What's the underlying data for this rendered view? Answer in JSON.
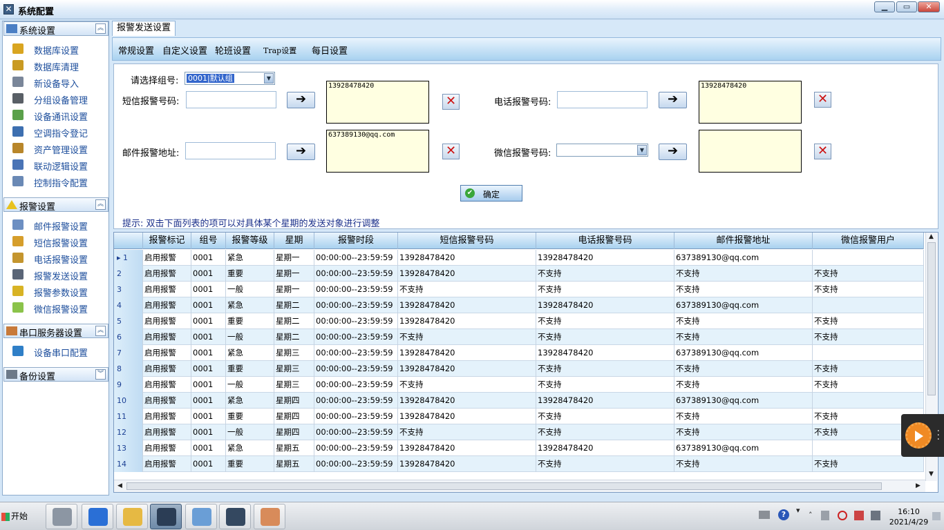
{
  "window": {
    "title": "系统配置",
    "min": "▁",
    "max": "▭",
    "close": "✕"
  },
  "sidebar": {
    "sections": [
      {
        "label": "系统设置",
        "toggle": "︽",
        "items": [
          {
            "label": "数据库设置",
            "icon": "database-icon",
            "color": "#d9a520"
          },
          {
            "label": "数据库清理",
            "icon": "database-clean-icon",
            "color": "#c99a22"
          },
          {
            "label": "新设备导入",
            "icon": "import-icon",
            "color": "#7a8699"
          },
          {
            "label": "分组设备管理",
            "icon": "group-icon",
            "color": "#595f66"
          },
          {
            "label": "设备通讯设置",
            "icon": "network-icon",
            "color": "#5aa04a"
          },
          {
            "label": "空调指令登记",
            "icon": "document-icon",
            "color": "#3d6fb0"
          },
          {
            "label": "资产管理设置",
            "icon": "asset-icon",
            "color": "#b8862a"
          },
          {
            "label": "联动逻辑设置",
            "icon": "logic-icon",
            "color": "#4a74b6"
          },
          {
            "label": "控制指令配置",
            "icon": "control-icon",
            "color": "#6a89b5"
          }
        ]
      },
      {
        "label": "报警设置",
        "toggle": "︽",
        "items": [
          {
            "label": "邮件报警设置",
            "icon": "mail-icon",
            "color": "#6d8fc2"
          },
          {
            "label": "短信报警设置",
            "icon": "sms-icon",
            "color": "#d69e2b"
          },
          {
            "label": "电话报警设置",
            "icon": "phone-icon",
            "color": "#c4952e"
          },
          {
            "label": "报警发送设置",
            "icon": "send-icon",
            "color": "#5a6577"
          },
          {
            "label": "报警参数设置",
            "icon": "warning-icon",
            "color": "#d8b324"
          },
          {
            "label": "微信报警设置",
            "icon": "wechat-icon",
            "color": "#8bc34a"
          }
        ]
      },
      {
        "label": "串口服务器设置",
        "toggle": "︽",
        "items": [
          {
            "label": "设备串口配置",
            "icon": "globe-icon",
            "color": "#2f7fc7"
          }
        ]
      },
      {
        "label": "备份设置",
        "toggle": "︾",
        "items": []
      }
    ]
  },
  "main": {
    "tab": "报警发送设置",
    "subtabs": [
      "常规设置",
      "自定义设置",
      "轮班设置",
      "Trap设置",
      "每日设置"
    ],
    "form": {
      "group_label": "请选择组号:",
      "group_value": "0001|默认组",
      "sms_label": "短信报警号码:",
      "sms_list": "13928478420",
      "phone_label": "电话报警号码:",
      "phone_list": "13928478420",
      "mail_label": "邮件报警地址:",
      "mail_list": "637389130@qq.com",
      "wechat_label": "微信报警号码:",
      "wechat_list": "",
      "arrow": "➔",
      "delete": "✕",
      "ok": "确定",
      "ok_icon": "✔",
      "hint": "提示: 双击下面列表的项可以对具体某个星期的发送对象进行调整"
    },
    "grid": {
      "columns": [
        "",
        "报警标记",
        "组号",
        "报警等级",
        "星期",
        "报警时段",
        "短信报警号码",
        "电话报警号码",
        "邮件报警地址",
        "微信报警用户"
      ],
      "rows": [
        [
          "▸ 1",
          "启用报警",
          "0001",
          "紧急",
          "星期一",
          "00:00:00--23:59:59",
          "13928478420",
          "13928478420",
          "637389130@qq.com",
          ""
        ],
        [
          "2",
          "启用报警",
          "0001",
          "重要",
          "星期一",
          "00:00:00--23:59:59",
          "13928478420",
          "不支持",
          "不支持",
          "不支持"
        ],
        [
          "3",
          "启用报警",
          "0001",
          "一般",
          "星期一",
          "00:00:00--23:59:59",
          "不支持",
          "不支持",
          "不支持",
          "不支持"
        ],
        [
          "4",
          "启用报警",
          "0001",
          "紧急",
          "星期二",
          "00:00:00--23:59:59",
          "13928478420",
          "13928478420",
          "637389130@qq.com",
          ""
        ],
        [
          "5",
          "启用报警",
          "0001",
          "重要",
          "星期二",
          "00:00:00--23:59:59",
          "13928478420",
          "不支持",
          "不支持",
          "不支持"
        ],
        [
          "6",
          "启用报警",
          "0001",
          "一般",
          "星期二",
          "00:00:00--23:59:59",
          "不支持",
          "不支持",
          "不支持",
          "不支持"
        ],
        [
          "7",
          "启用报警",
          "0001",
          "紧急",
          "星期三",
          "00:00:00--23:59:59",
          "13928478420",
          "13928478420",
          "637389130@qq.com",
          ""
        ],
        [
          "8",
          "启用报警",
          "0001",
          "重要",
          "星期三",
          "00:00:00--23:59:59",
          "13928478420",
          "不支持",
          "不支持",
          "不支持"
        ],
        [
          "9",
          "启用报警",
          "0001",
          "一般",
          "星期三",
          "00:00:00--23:59:59",
          "不支持",
          "不支持",
          "不支持",
          "不支持"
        ],
        [
          "10",
          "启用报警",
          "0001",
          "紧急",
          "星期四",
          "00:00:00--23:59:59",
          "13928478420",
          "13928478420",
          "637389130@qq.com",
          ""
        ],
        [
          "11",
          "启用报警",
          "0001",
          "重要",
          "星期四",
          "00:00:00--23:59:59",
          "13928478420",
          "不支持",
          "不支持",
          "不支持"
        ],
        [
          "12",
          "启用报警",
          "0001",
          "一般",
          "星期四",
          "00:00:00--23:59:59",
          "不支持",
          "不支持",
          "不支持",
          "不支持"
        ],
        [
          "13",
          "启用报警",
          "0001",
          "紧急",
          "星期五",
          "00:00:00--23:59:59",
          "13928478420",
          "13928478420",
          "637389130@qq.com",
          ""
        ],
        [
          "14",
          "启用报警",
          "0001",
          "重要",
          "星期五",
          "00:00:00--23:59:59",
          "13928478420",
          "不支持",
          "不支持",
          "不支持"
        ]
      ]
    }
  },
  "taskbar": {
    "start": "开始",
    "apps": [
      {
        "icon": "server-icon",
        "color": "#8c96a3"
      },
      {
        "icon": "powershell-icon",
        "color": "#2a6fd6"
      },
      {
        "icon": "folder-icon",
        "color": "#e6b943"
      },
      {
        "icon": "tools-icon",
        "color": "#2b3d55"
      },
      {
        "icon": "control-panel-icon",
        "color": "#6a9ed6"
      },
      {
        "icon": "app-icon",
        "color": "#344860"
      },
      {
        "icon": "paint-icon",
        "color": "#d88b5a"
      }
    ],
    "time": "16:10",
    "date": "2021/4/29"
  }
}
